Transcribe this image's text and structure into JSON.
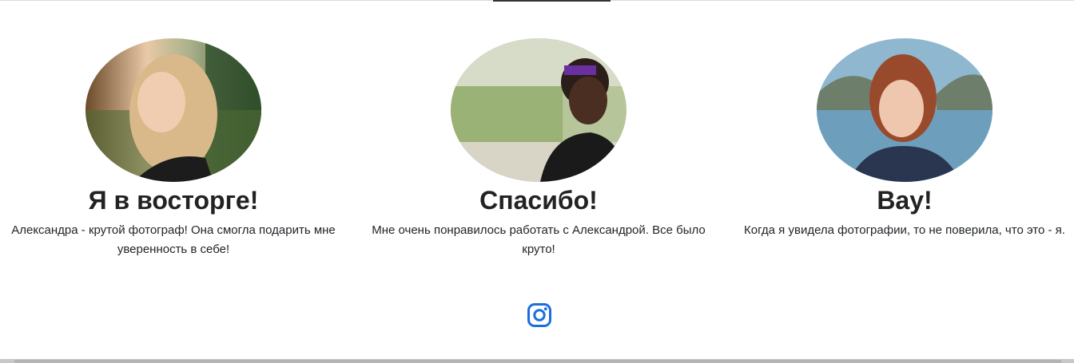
{
  "testimonials": [
    {
      "photo_icon": "portrait-blonde-woman",
      "title": "Я в восторге!",
      "text": "Александра - крутой фотограф! Она смогла подарить мне уверенность в себе!"
    },
    {
      "photo_icon": "portrait-smiling-woman",
      "title": "Спасибо!",
      "text": "Мне очень понравилось работать с Александрой. Все было круто!"
    },
    {
      "photo_icon": "portrait-redhead-woman",
      "title": "Вау!",
      "text": "Когда я увидела фотографии, то не поверила, что это - я."
    }
  ],
  "footer": {
    "social_icon": "instagram-icon",
    "accent_color": "#1b6ee0"
  }
}
